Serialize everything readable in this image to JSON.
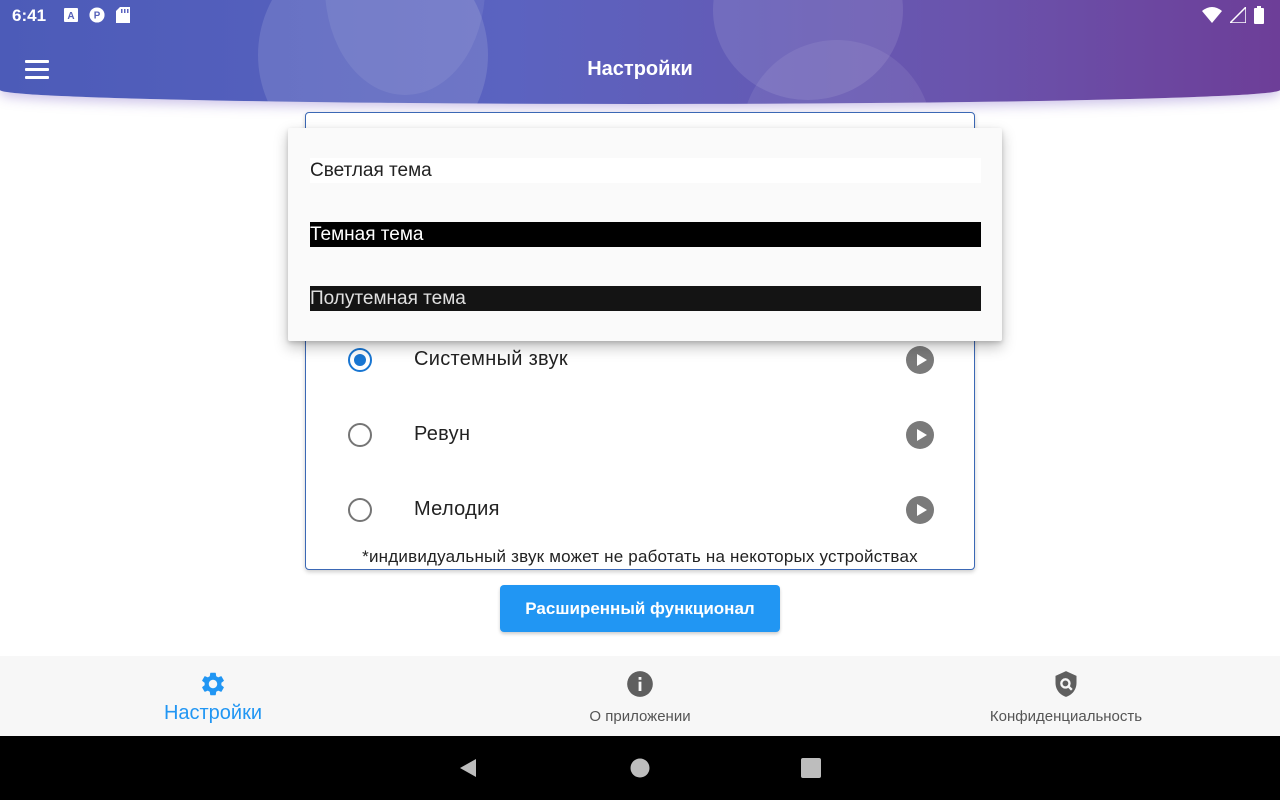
{
  "status_bar": {
    "time": "6:41",
    "left_icons": [
      "a-badge-icon",
      "p-badge-icon",
      "sd-card-icon"
    ],
    "right_icons": [
      "wifi-icon",
      "signal-icon",
      "battery-icon"
    ]
  },
  "app_bar": {
    "title": "Настройки"
  },
  "theme_dropdown": {
    "options": [
      {
        "label": "Светлая тема"
      },
      {
        "label": "Темная тема"
      },
      {
        "label": "Полутемная тема"
      }
    ]
  },
  "sound_settings": {
    "options": [
      {
        "label": "Системный звук",
        "selected": true
      },
      {
        "label": "Ревун",
        "selected": false
      },
      {
        "label": "Мелодия",
        "selected": false
      }
    ],
    "note": "*индивидуальный звук может не работать на некоторых устройствах"
  },
  "action_button": {
    "label": "Расширенный функционал"
  },
  "bottom_nav": {
    "items": [
      {
        "label": "Настройки",
        "icon": "gear-icon",
        "active": true
      },
      {
        "label": "О приложении",
        "icon": "info-icon",
        "active": false
      },
      {
        "label": "Конфиденциальность",
        "icon": "privacy-shield-icon",
        "active": false
      }
    ]
  },
  "colors": {
    "accent": "#2196f3",
    "radio_selected": "#1976d2",
    "header_gradient_start": "#4c5bb8",
    "header_gradient_end": "#6d3e98"
  }
}
